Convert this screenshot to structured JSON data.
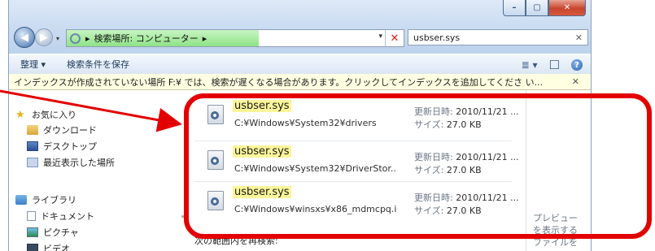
{
  "window": {
    "caption_buttons": {
      "minimize": "–",
      "maximize": "▢",
      "close": "✕"
    },
    "nav_back": "◀",
    "nav_forward": "▶",
    "address": {
      "breadcrumb": "検索場所: コンピューター",
      "chevron": "▸",
      "dropdown": "▾",
      "clear": "✕"
    },
    "search": {
      "value": "usbser.sys",
      "clear": "✕"
    }
  },
  "toolbar": {
    "organize_label": "整理 ▾",
    "save_search_label": "検索条件を保存",
    "view_icon": "≣ ▾",
    "pane_icon": "☐",
    "help_icon": "?"
  },
  "infobar": {
    "text": "インデックスが作成されていない場所 F:¥ では、検索が遅くなる場合があります。クリックしてインデックスを追加してくださ い...",
    "close": "✕"
  },
  "nav": {
    "favorites": "お気に入り",
    "downloads": "ダウンロード",
    "desktop": "デスクトップ",
    "recent": "最近表示した場所",
    "libraries": "ライブラリ",
    "documents": "ドキュメント",
    "pictures": "ピクチャ",
    "videos": "ビデオ"
  },
  "results": [
    {
      "name": "usbser.sys",
      "path": "C:¥Windows¥System32¥drivers",
      "date_label": "更新日時: ",
      "date": "2010/11/21 ...",
      "size_label": "サイズ: ",
      "size": "27.0 KB"
    },
    {
      "name": "usbser.sys",
      "path": "C:¥Windows¥System32¥DriverStor...",
      "date_label": "更新日時: ",
      "date": "2010/11/21 ...",
      "size_label": "サイズ: ",
      "size": "27.0 KB"
    },
    {
      "name": "usbser.sys",
      "path": "C:¥Windows¥winsxs¥x86_mdmcpq.i...",
      "date_label": "更新日時: ",
      "date": "2010/11/21 ...",
      "size_label": "サイズ: ",
      "size": "27.0 KB"
    }
  ],
  "research_label": "次の範囲内を再検索:",
  "preview_text": "プレビュー\nを表示する\nファイルを",
  "colors": {
    "annotation_red": "#e30000",
    "highlight_yellow": "#fbf59a",
    "address_green": "#8ee387"
  }
}
